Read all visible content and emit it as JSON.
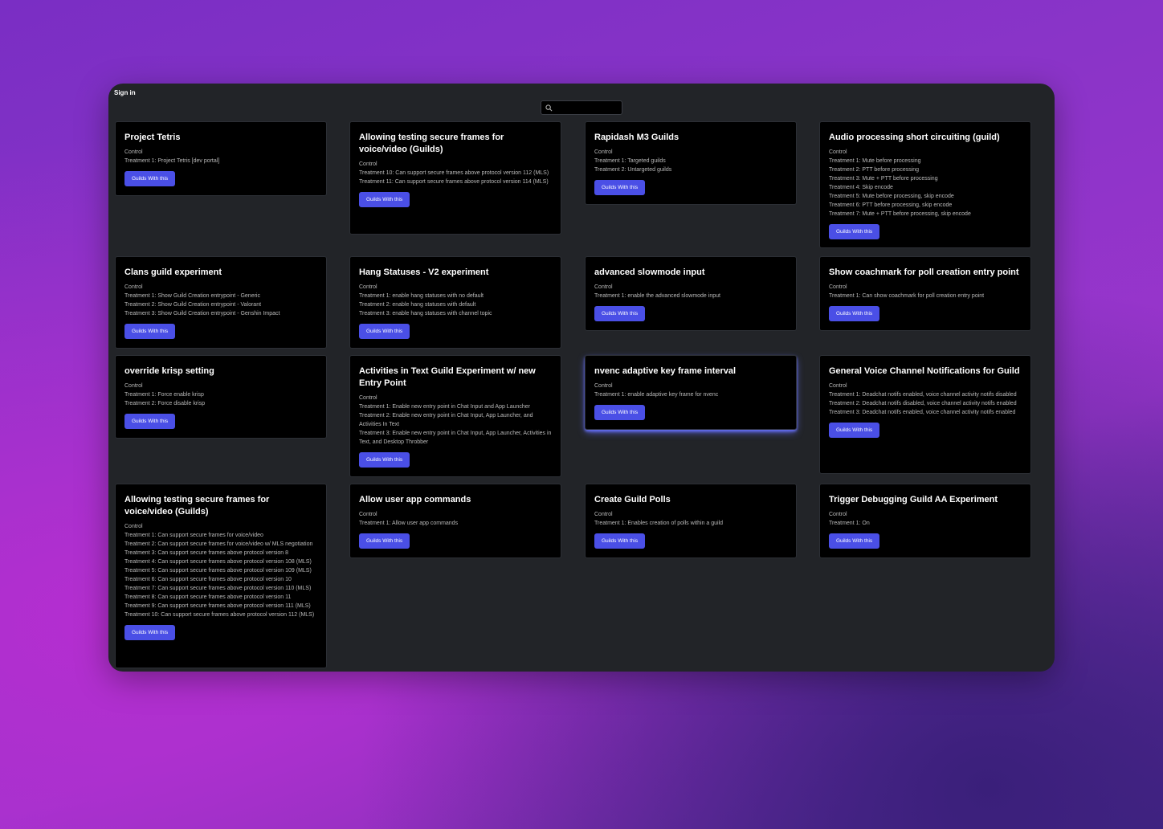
{
  "header": {
    "sign_in": "Sign in",
    "search_placeholder": ""
  },
  "button_label": "Guilds With this",
  "experiments": [
    {
      "title": "Project Tetris",
      "lines": [
        "Control",
        "Treatment 1: Project Tetris [dev portal]"
      ]
    },
    {
      "title": "Allowing testing secure frames for voice/video (Guilds)",
      "lines": [
        "Control",
        "Treatment 10: Can support secure frames above protocol version 112 (MLS)",
        "Treatment 11: Can support secure frames above protocol version 114 (MLS)"
      ]
    },
    {
      "title": "Rapidash M3 Guilds",
      "lines": [
        "Control",
        "Treatment 1: Targeted guilds",
        "Treatment 2: Untargeted guilds"
      ]
    },
    {
      "title": "Audio processing short circuiting (guild)",
      "lines": [
        "Control",
        "Treatment 1: Mute before processing",
        "Treatment 2: PTT before processing",
        "Treatment 3: Mute + PTT before processing",
        "Treatment 4: Skip encode",
        "Treatment 5: Mute before processing, skip encode",
        "Treatment 6: PTT before processing, skip encode",
        "Treatment 7: Mute + PTT before processing, skip encode"
      ]
    },
    {
      "title": "Clans guild experiment",
      "lines": [
        "Control",
        "Treatment 1: Show Guild Creation entrypoint - Generic",
        "Treatment 2: Show Guild Creation entrypoint - Valorant",
        "Treatment 3: Show Guild Creation entrypoint - Genshin Impact"
      ]
    },
    {
      "title": "Hang Statuses - V2 experiment",
      "lines": [
        "Control",
        "Treatment 1: enable hang statuses with no default",
        "Treatment 2: enable hang statuses with default",
        "Treatment 3: enable hang statuses with channel topic"
      ]
    },
    {
      "title": "advanced slowmode input",
      "lines": [
        "Control",
        "Treatment 1: enable the advanced slowmode input"
      ]
    },
    {
      "title": "Show coachmark for poll creation entry point",
      "lines": [
        "Control",
        "Treatment 1: Can show coachmark for poll creation entry point"
      ]
    },
    {
      "title": "override krisp setting",
      "lines": [
        "Control",
        "Treatment 1: Force enable krisp",
        "Treatment 2: Force disable krisp"
      ]
    },
    {
      "title": "Activities in Text Guild Experiment w/ new Entry Point",
      "lines": [
        "Control",
        "Treatment 1: Enable new entry point in Chat Input and App Launcher",
        "Treatment 2: Enable new entry point in Chat Input, App Launcher, and Activities In Text",
        "Treatment 3: Enable new entry point in Chat Input, App Launcher, Activities in Text, and Desktop Throbber"
      ]
    },
    {
      "title": "nvenc adaptive key frame interval",
      "lines": [
        "Control",
        "Treatment 1: enable adaptive key frame for nvenc"
      ]
    },
    {
      "title": "General Voice Channel Notifications for Guild",
      "lines": [
        "Control",
        "Treatment 1: Deadchat notifs enabled, voice channel activity notifs disabled",
        "Treatment 2: Deadchat notifs disabled, voice channel activity notifs enabled",
        "Treatment 3: Deadchat notifs enabled, voice channel activity notifs enabled"
      ]
    },
    {
      "title": "Allowing testing secure frames for voice/video (Guilds)",
      "lines": [
        "Control",
        "Treatment 1: Can support secure frames for voice/video",
        "Treatment 2: Can support secure frames for voice/video w/ MLS negotiation",
        "Treatment 3: Can support secure frames above protocol version 8",
        "Treatment 4: Can support secure frames above protocol version 108 (MLS)",
        "Treatment 5: Can support secure frames above protocol version 109 (MLS)",
        "Treatment 6: Can support secure frames above protocol version 10",
        "Treatment 7: Can support secure frames above protocol version 110 (MLS)",
        "Treatment 8: Can support secure frames above protocol version 11",
        "Treatment 9: Can support secure frames above protocol version 111 (MLS)",
        "Treatment 10: Can support secure frames above protocol version 112 (MLS)"
      ]
    },
    {
      "title": "Allow user app commands",
      "lines": [
        "Control",
        "Treatment 1: Allow user app commands"
      ]
    },
    {
      "title": "Create Guild Polls",
      "lines": [
        "Control",
        "Treatment 1: Enables creation of polls within a guild"
      ]
    },
    {
      "title": "Trigger Debugging Guild AA Experiment",
      "lines": [
        "Control",
        "Treatment 1: On"
      ]
    }
  ]
}
